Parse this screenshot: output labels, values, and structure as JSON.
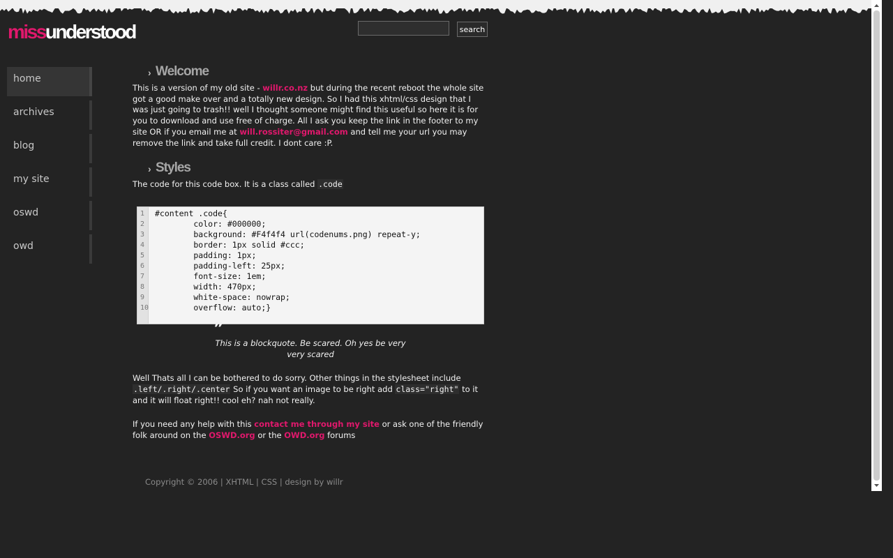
{
  "header": {
    "logo_part1": "miss",
    "logo_part2": "understood",
    "search_placeholder": "",
    "search_button_label": "search"
  },
  "nav": {
    "items": [
      {
        "label": "home",
        "active": true
      },
      {
        "label": "archives"
      },
      {
        "label": "blog"
      },
      {
        "label": "my site"
      },
      {
        "label": "oswd"
      },
      {
        "label": "owd"
      }
    ]
  },
  "welcome": {
    "title": "Welcome",
    "text1": "This is a version of my old site - ",
    "link1": "willr.co.nz",
    "text2": " but during the recent reboot the whole site got a good make over and a totally new design. So I had this xhtml/css design that I was just going to trash!! well I thought someone might find this useful so here it is for you to download and use free of charge. All I ask you keep the link in the footer to my site OR if you email me at ",
    "link2": "will.rossiter@gmail.com",
    "text3": " and tell me your url you may remove the link and take full credit. I dont care :P."
  },
  "styles": {
    "title": "Styles",
    "intro": "The code for this code box. It is a class called ",
    "intro_code": ".code",
    "code_lines": [
      {
        "num": "1",
        "text": "#content .code{"
      },
      {
        "num": "2",
        "text": "        color: #000000;"
      },
      {
        "num": "3",
        "text": "        background: #F4f4f4 url(codenums.png) repeat-y;"
      },
      {
        "num": "4",
        "text": "        border: 1px solid #ccc;"
      },
      {
        "num": "5",
        "text": "        padding: 1px;"
      },
      {
        "num": "6",
        "text": "        padding-left: 25px;"
      },
      {
        "num": "7",
        "text": "        font-size: 1em;"
      },
      {
        "num": "8",
        "text": "        width: 470px;"
      },
      {
        "num": "9",
        "text": "        white-space: nowrap;"
      },
      {
        "num": "10",
        "text": "        overflow: auto;}"
      }
    ],
    "quote_mark": "”",
    "blockquote": "This is a blockquote. Be scared. Oh yes be very very scared",
    "p2_text1": "Well Thats all I can be bothered to do sorry. Other things in the stylesheet include ",
    "p2_code1": ".left/.right/.center",
    "p2_text2": " So if you want an image to be right add ",
    "p2_code2": "class=\"right\"",
    "p2_text3": " to it and it will float right!! cool eh? nah not really.",
    "p3_text1": "If you need any help with this ",
    "p3_link1": "contact me through my site",
    "p3_text2": " or ask one of the friendly folk around on the ",
    "p3_link2": "OSWD.org",
    "p3_text3": " or the ",
    "p3_link3": "OWD.org",
    "p3_text4": " forums"
  },
  "footer": {
    "copyright": "Copyright © 2006 | ",
    "xhtml": "XHTML",
    "sep1": " | ",
    "css": "CSS",
    "sep2": " | ",
    "design": "design by willr"
  }
}
